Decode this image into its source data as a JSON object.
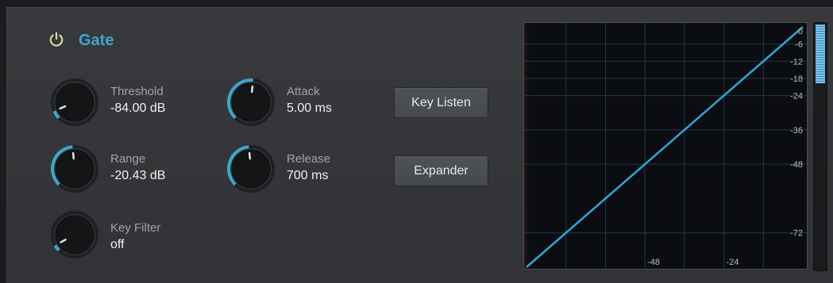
{
  "gate": {
    "title": "Gate",
    "power_on": true,
    "accent_color": "#3fa5d2"
  },
  "params": {
    "threshold": {
      "label": "Threshold",
      "value": "-84.00 dB",
      "knob_fraction": 0.08
    },
    "range": {
      "label": "Range",
      "value": "-20.43 dB",
      "knob_fraction": 0.48
    },
    "key_filter": {
      "label": "Key Filter",
      "value": "off",
      "knob_fraction": 0.06
    },
    "attack": {
      "label": "Attack",
      "value": "5.00 ms",
      "knob_fraction": 0.52
    },
    "release": {
      "label": "Release",
      "value": "700 ms",
      "knob_fraction": 0.48
    }
  },
  "buttons": {
    "key_listen": "Key Listen",
    "expander": "Expander"
  },
  "graph": {
    "y_labels": [
      "0",
      "-6",
      "-12",
      "-18",
      "-24",
      "-36",
      "-48",
      "-72"
    ],
    "x_labels": [
      "-48",
      "-24"
    ],
    "transfer": "unity"
  },
  "meter": {
    "level_fraction": 0.24
  }
}
